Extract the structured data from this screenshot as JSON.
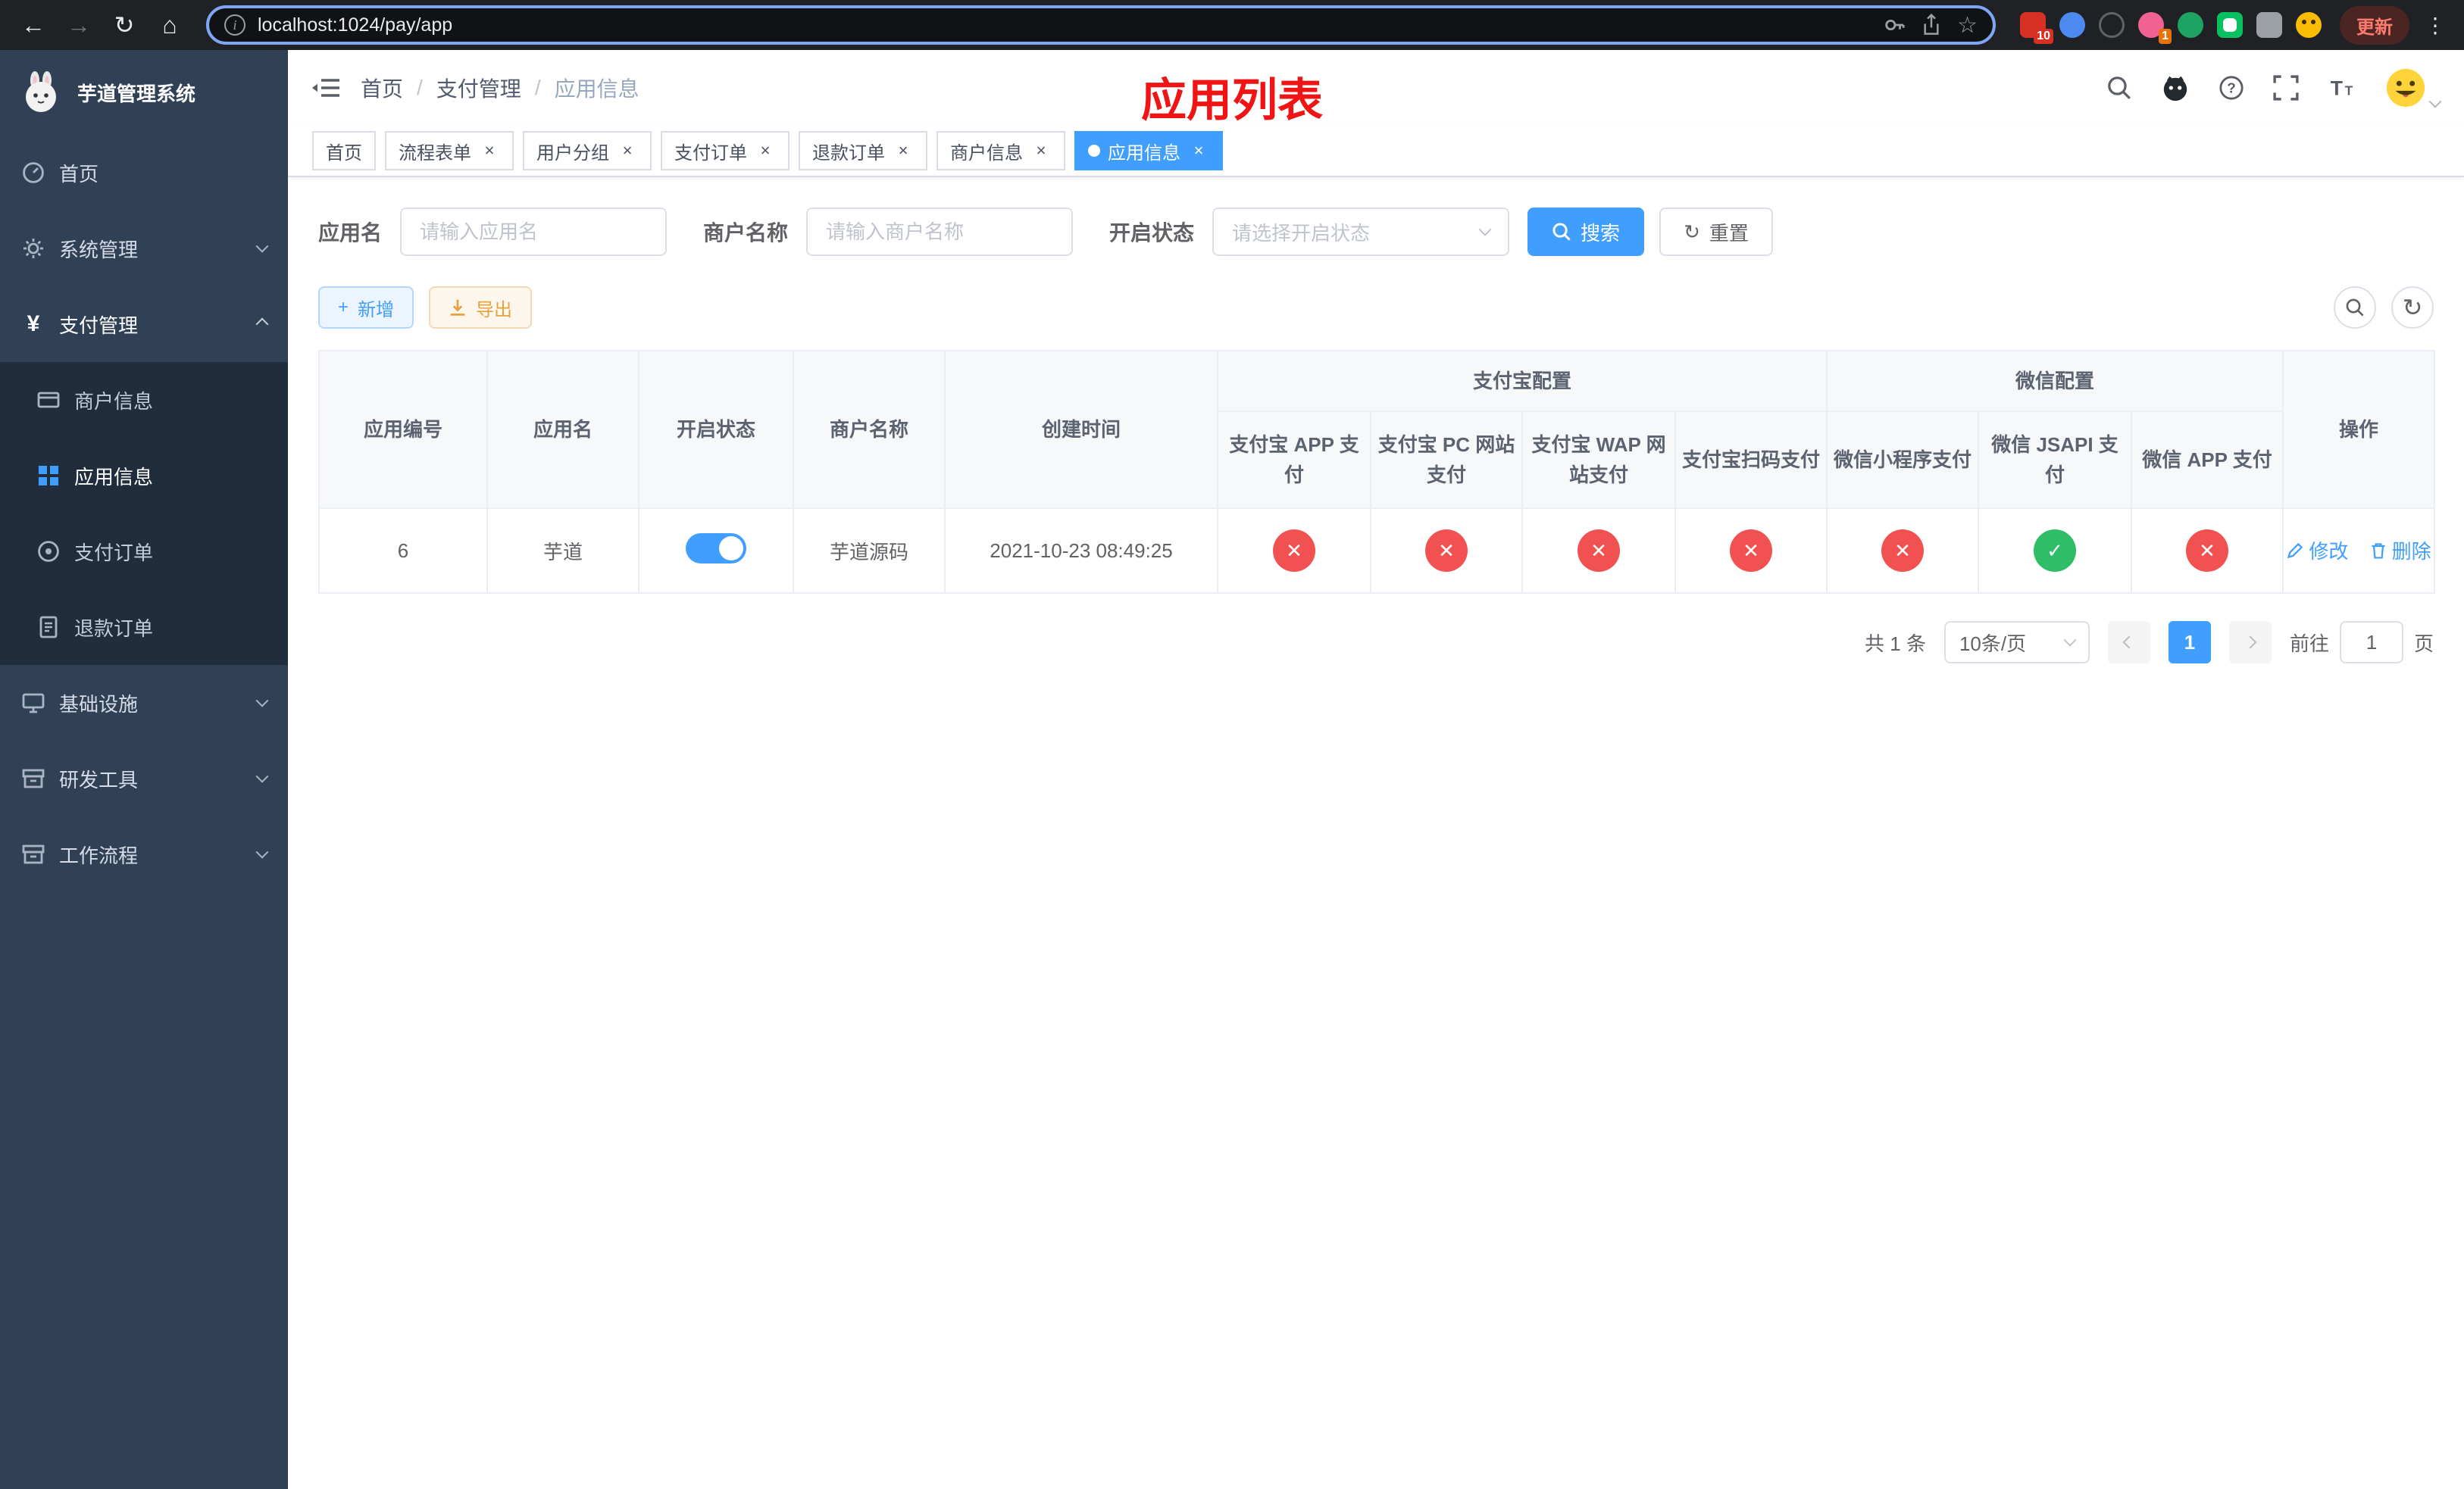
{
  "browser": {
    "url": "localhost:1024/pay/app",
    "update_label": "更新",
    "extension_badge_1": "10",
    "extension_badge_2": "1"
  },
  "sidebar": {
    "title": "芋道管理系统",
    "items": [
      {
        "label": "首页"
      },
      {
        "label": "系统管理"
      },
      {
        "label": "支付管理"
      },
      {
        "label": "商户信息"
      },
      {
        "label": "应用信息"
      },
      {
        "label": "支付订单"
      },
      {
        "label": "退款订单"
      },
      {
        "label": "基础设施"
      },
      {
        "label": "研发工具"
      },
      {
        "label": "工作流程"
      }
    ]
  },
  "header": {
    "breadcrumb": [
      "首页",
      "支付管理",
      "应用信息"
    ],
    "page_title": "应用列表"
  },
  "tabs": [
    {
      "label": "首页"
    },
    {
      "label": "流程表单"
    },
    {
      "label": "用户分组"
    },
    {
      "label": "支付订单"
    },
    {
      "label": "退款订单"
    },
    {
      "label": "商户信息"
    },
    {
      "label": "应用信息"
    }
  ],
  "filters": {
    "app_name_label": "应用名",
    "app_name_placeholder": "请输入应用名",
    "merchant_label": "商户名称",
    "merchant_placeholder": "请输入商户名称",
    "status_label": "开启状态",
    "status_placeholder": "请选择开启状态",
    "search_label": "搜索",
    "reset_label": "重置"
  },
  "toolbar": {
    "add_label": "新增",
    "export_label": "导出"
  },
  "table": {
    "group_headers": {
      "alipay": "支付宝配置",
      "wechat": "微信配置"
    },
    "columns": [
      "应用编号",
      "应用名",
      "开启状态",
      "商户名称",
      "创建时间",
      "支付宝 APP 支付",
      "支付宝 PC 网站支付",
      "支付宝 WAP 网站支付",
      "支付宝扫码支付",
      "微信小程序支付",
      "微信 JSAPI 支付",
      "微信 APP 支付",
      "操作"
    ],
    "rows": [
      {
        "id": "6",
        "name": "芋道",
        "status_on": true,
        "merchant": "芋道源码",
        "created": "2021-10-23 08:49:25",
        "channels": [
          "no",
          "no",
          "no",
          "no",
          "no",
          "yes",
          "no"
        ],
        "edit_label": "修改",
        "delete_label": "删除"
      }
    ]
  },
  "pagination": {
    "total_label": "共 1 条",
    "page_size": "10条/页",
    "current_page": "1",
    "goto_label": "前往",
    "goto_value": "1",
    "page_unit": "页"
  },
  "colors": {
    "accent": "#409EFF",
    "title_red": "#F01414",
    "success_green": "#2FBE67",
    "danger_red": "#F25151",
    "sidebar_bg": "#304156",
    "submenu_bg": "#1F2D3D"
  }
}
